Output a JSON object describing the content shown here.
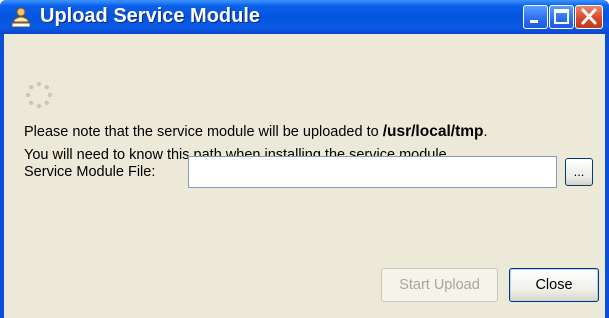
{
  "window": {
    "title": "Upload Service Module",
    "title_icon": "upload-user-icon",
    "controls": [
      "minimize-icon",
      "maximize-icon",
      "close-icon"
    ]
  },
  "status": {
    "indicator": "loading-spinner-icon"
  },
  "note": {
    "line1_prefix": "Please note that the service module will be uploaded to ",
    "path": "/usr/local/tmp",
    "line1_suffix": ".",
    "line2": "You will need to know this path when installing the service module."
  },
  "file_field": {
    "label": "Service Module File:",
    "value": "",
    "browse_label": "..."
  },
  "buttons": {
    "start_upload": "Start Upload",
    "start_upload_enabled": false,
    "close": "Close"
  },
  "colors": {
    "titlebar": "#0554e0",
    "dialog_bg": "#ece9d8",
    "close_button_red": "#d8472a",
    "disabled_text": "#a9a797"
  }
}
